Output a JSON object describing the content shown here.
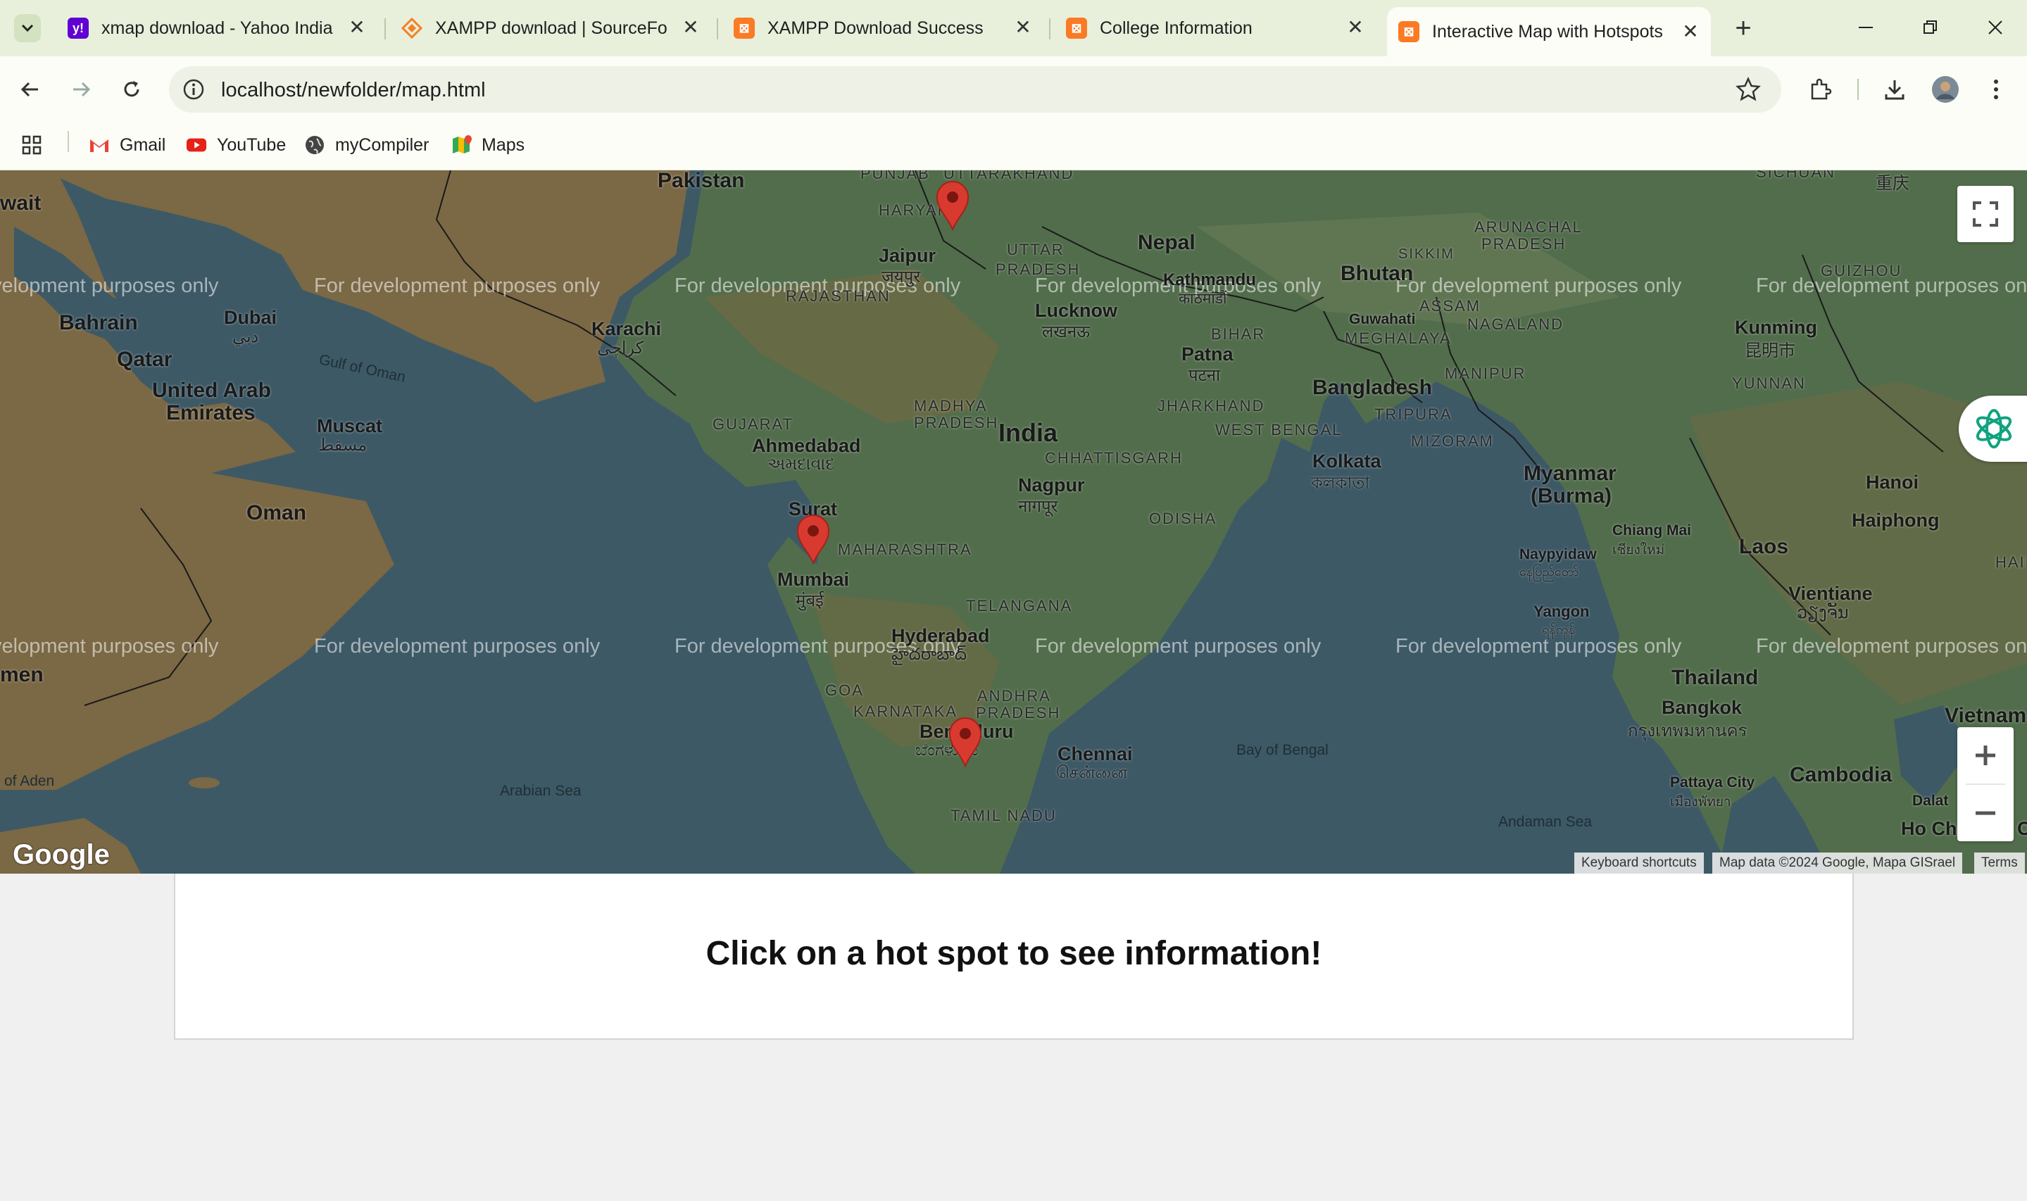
{
  "browser": {
    "tabs": [
      {
        "title": "xmap download - Yahoo India S",
        "icon": "yahoo-icon",
        "color": "#6001d2"
      },
      {
        "title": "XAMPP download | SourceForg",
        "icon": "sourceforge-icon",
        "color": "#f48024"
      },
      {
        "title": "XAMPP Download Success",
        "icon": "xampp-icon",
        "color": "#fb7a24"
      },
      {
        "title": "College Information",
        "icon": "xampp-icon",
        "color": "#fb7a24"
      },
      {
        "title": "Interactive Map with Hotspots",
        "icon": "xampp-icon",
        "color": "#fb7a24",
        "active": true
      }
    ],
    "url": "localhost/newfolder/map.html",
    "bookmarks": [
      {
        "label": "Gmail",
        "icon": "gmail-icon"
      },
      {
        "label": "YouTube",
        "icon": "youtube-icon"
      },
      {
        "label": "myCompiler",
        "icon": "globe-icon"
      },
      {
        "label": "Maps",
        "icon": "maps-icon"
      }
    ]
  },
  "map": {
    "watermark": "For development purposes only",
    "countries": {
      "pakistan": "Pakistan",
      "nepal": "Nepal",
      "bhutan": "Bhutan",
      "bangladesh": "Bangladesh",
      "india": "India",
      "oman": "Oman",
      "bahrain": "Bahrain",
      "qatar": "Qatar",
      "uae_1": "United Arab",
      "uae_2": "Emirates",
      "myanmar_1": "Myanmar",
      "myanmar_2": "(Burma)",
      "laos": "Laos",
      "thailand": "Thailand",
      "cambodia": "Cambodia",
      "vietnam": "Vietnam",
      "kuwait_partial": "wait",
      "yemen_partial": "men"
    },
    "cities": {
      "jaipur": "Jaipur",
      "jaipur_local": "जयपुर",
      "karachi": "Karachi",
      "karachi_local": "کراچی",
      "dubai": "Dubai",
      "dubai_local": "دبي",
      "muscat": "Muscat",
      "muscat_local": "مسقط",
      "lucknow": "Lucknow",
      "lucknow_local": "लखनऊ",
      "kathmandu": "Kathmandu",
      "kathmandu_local": "काठमाडौं",
      "patna": "Patna",
      "patna_local": "पटना",
      "guwahati": "Guwahati",
      "ahmedabad": "Ahmedabad",
      "ahmedabad_local": "અમદાવાદ",
      "surat": "Surat",
      "mumbai": "Mumbai",
      "mumbai_local": "मुंबई",
      "nagpur": "Nagpur",
      "nagpur_local": "नागपूर",
      "kolkata": "Kolkata",
      "kolkata_local": "কলকাতা",
      "hyderabad": "Hyderabad",
      "hyderabad_local": "హైదరాబాద్",
      "bengaluru": "Bengaluru",
      "bengaluru_local": "ಬೆಂಗಳೂರು",
      "chennai": "Chennai",
      "chennai_local": "சென்னை",
      "kunming": "Kunming",
      "kunming_local": "昆明市",
      "chongqing_local": "重庆",
      "naypyidaw": "Naypyidaw",
      "naypyidaw_local": "နေပြည်တော်",
      "yangon": "Yangon",
      "yangon_local": "ရန်ကုန်",
      "chiangmai": "Chiang Mai",
      "chiangmai_local": "เชียงใหม่",
      "vientiane": "Vientiane",
      "vientiane_local": "ວຽງຈັນ",
      "hanoi": "Hanoi",
      "haiphong": "Haiphong",
      "bangkok": "Bangkok",
      "bangkok_local": "กรุงเทพมหานคร",
      "pattaya": "Pattaya City",
      "pattaya_local": "เมืองพัทยา",
      "hochiminh": "Ho Chi Minh City",
      "dalat": "Dalat"
    },
    "regions": {
      "punjab": "PUNJAB",
      "uttarakhand": "UTTARAKHAND",
      "haryana": "HARYANA",
      "uttar_pradesh_1": "UTTAR",
      "uttar_pradesh_2": "PRADESH",
      "rajasthan": "RAJASTHAN",
      "bihar": "BIHAR",
      "jharkhand": "JHARKHAND",
      "gujarat": "GUJARAT",
      "madhya_pradesh_1": "MADHYA",
      "madhya_pradesh_2": "PRADESH",
      "chhattisgarh": "CHHATTISGARH",
      "west_bengal": "WEST BENGAL",
      "odisha": "ODISHA",
      "maharashtra": "MAHARASHTRA",
      "telangana": "TELANGANA",
      "goa": "GOA",
      "karnataka": "KARNATAKA",
      "andhra_1": "ANDHRA",
      "andhra_2": "PRADESH",
      "tamil_nadu": "TAMIL NADU",
      "sikkim": "SIKKIM",
      "arunachal_1": "ARUNACHAL",
      "arunachal_2": "PRADESH",
      "assam": "ASSAM",
      "nagaland": "NAGALAND",
      "meghalaya": "MEGHALAYA",
      "manipur": "MANIPUR",
      "tripura": "TRIPURA",
      "mizoram": "MIZORAM",
      "guizhou": "GUIZHOU",
      "yunnan": "YUNNAN",
      "sichuan": "SICHUAN",
      "hainan": "HAINAN"
    },
    "seas": {
      "gulf_of_oman": "Gulf of Oman",
      "arabian_sea": "Arabian Sea",
      "bay_of_bengal": "Bay of Bengal",
      "andaman_sea": "Andaman Sea",
      "gulf_of_aden": "of Aden"
    },
    "attribution": {
      "shortcuts": "Keyboard shortcuts",
      "data": "Map data ©2024 Google, Mapa GISrael",
      "terms": "Terms"
    },
    "logo": "Google",
    "hotspot_count": 3
  },
  "panel": {
    "message": "Click on a hot spot to see information!"
  },
  "colors": {
    "sea": "#3d5966",
    "land_dry": "#7b6845",
    "land_green": "#526d4c",
    "pin": "#d93a2f",
    "chrome_tabstrip": "#e8f0dc"
  }
}
